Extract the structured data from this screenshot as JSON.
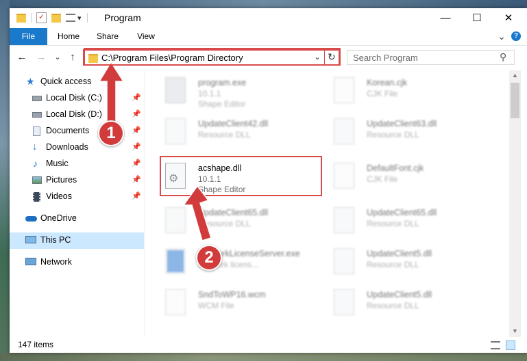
{
  "window": {
    "title": "Program"
  },
  "titlebar": {
    "minimize": "—",
    "maximize": "☐",
    "close": "✕",
    "quick_access_dropdown": "▾"
  },
  "ribbon": {
    "tabs": [
      "File",
      "Home",
      "Share",
      "View"
    ],
    "expand": "⌄",
    "help": "?"
  },
  "address": {
    "path": "C:\\Program Files\\Program Directory",
    "search_placeholder": "Search Program",
    "back": "←",
    "forward": "→",
    "recent": "⌄",
    "up": "↑",
    "dropdown": "⌄",
    "refresh": "↻",
    "search": "⚲"
  },
  "nav": {
    "items": [
      {
        "label": "Quick access",
        "icon": "star-icon"
      },
      {
        "label": "Local Disk (C:)",
        "icon": "drive-icon",
        "pinned": true
      },
      {
        "label": "Local Disk (D:)",
        "icon": "drive-icon",
        "pinned": true
      },
      {
        "label": "Documents",
        "icon": "documents-icon",
        "pinned": true
      },
      {
        "label": "Downloads",
        "icon": "download-icon",
        "pinned": true
      },
      {
        "label": "Music",
        "icon": "music-icon",
        "pinned": true
      },
      {
        "label": "Pictures",
        "icon": "pictures-icon",
        "pinned": true
      },
      {
        "label": "Videos",
        "icon": "videos-icon",
        "pinned": true
      },
      {
        "label": "OneDrive",
        "icon": "cloud-icon"
      },
      {
        "label": "This PC",
        "icon": "computer-icon",
        "selected": true
      },
      {
        "label": "Network",
        "icon": "network-icon"
      }
    ],
    "pin_glyph": "📌"
  },
  "files": {
    "left": [
      {
        "name": "program.exe",
        "version": "10.1.1",
        "desc": "Shape Editor",
        "icon": "exe-icon"
      },
      {
        "name": "UpdateClient42.dll",
        "version": "Resource DLL",
        "desc": "",
        "icon": "dll-icon"
      },
      {
        "name": "acshape.dll",
        "version": "10.1.1",
        "desc": "Shape Editor",
        "icon": "dll-icon",
        "highlighted": true
      },
      {
        "name": "UpdateClient65.dll",
        "version": "Resource DLL",
        "desc": "",
        "icon": "dll-icon"
      },
      {
        "name": "NetworkLicenseServer.exe",
        "version": "Network licens...",
        "desc": "",
        "icon": "exe-icon"
      },
      {
        "name": "SndToWP16.wcm",
        "version": "WCM File",
        "desc": "",
        "icon": "file-icon"
      }
    ],
    "right": [
      {
        "name": "Korean.cjk",
        "version": "CJK File",
        "icon": "file-icon"
      },
      {
        "name": "UpdateClient63.dll",
        "version": "Resource DLL",
        "icon": "dll-icon"
      },
      {
        "name": "DefaultFont.cjk",
        "version": "CJK File",
        "icon": "file-icon"
      },
      {
        "name": "UpdateClient65.dll",
        "version": "Resource DLL",
        "icon": "dll-icon"
      },
      {
        "name": "UpdateClient5.dll",
        "version": "Resource DLL",
        "icon": "dll-icon"
      },
      {
        "name": "UpdateClient5.dll",
        "version": "Resource DLL",
        "icon": "dll-icon"
      }
    ]
  },
  "status": {
    "count": "147 items"
  },
  "annotations": {
    "step1": "1",
    "step2": "2",
    "color": "#d94b4b"
  }
}
